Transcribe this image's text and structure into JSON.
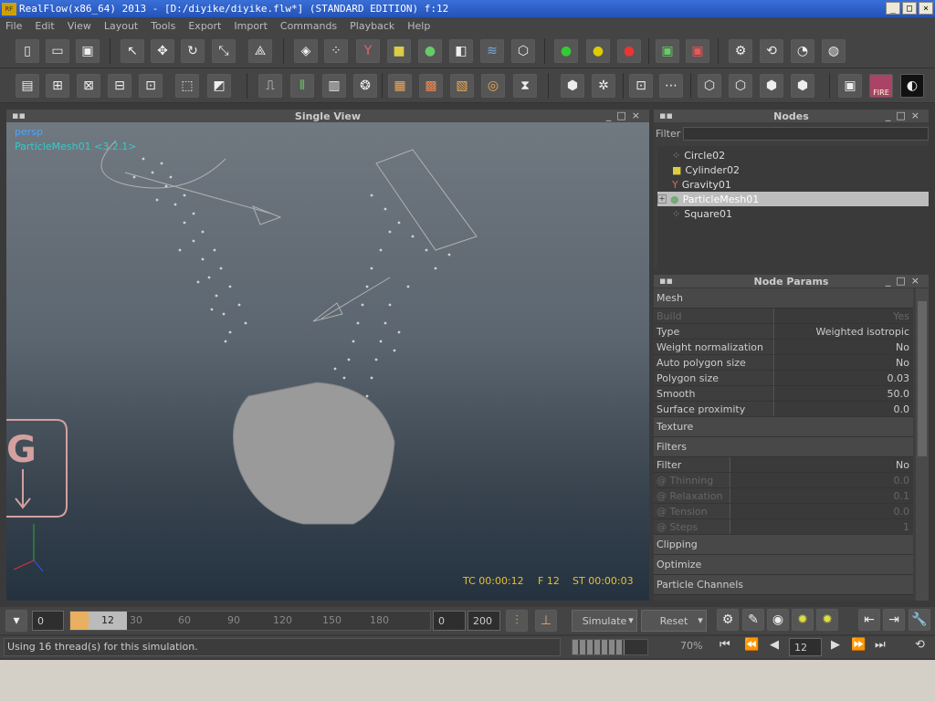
{
  "window": {
    "title": "RealFlow(x86_64) 2013 - [D:/diyike/diyike.flw*] (STANDARD EDITION) f:12",
    "logo_text": "RF",
    "minimize": "_",
    "maximize": "□",
    "close": "×"
  },
  "menu": [
    "File",
    "Edit",
    "View",
    "Layout",
    "Tools",
    "Export",
    "Import",
    "Commands",
    "Playback",
    "Help"
  ],
  "viewport": {
    "title": "Single View",
    "camera": "persp",
    "selected_label": "ParticleMesh01 <3.2.1>",
    "gravity_letter": "G",
    "tc": "TC 00:00:12",
    "frame": "F 12",
    "st": "ST 00:00:03"
  },
  "nodes": {
    "title": "Nodes",
    "filter_label": "Filter",
    "filter_value": "",
    "items": [
      {
        "name": "Circle02",
        "icon": "emitter-icon"
      },
      {
        "name": "Cylinder02",
        "icon": "object-icon"
      },
      {
        "name": "Gravity01",
        "icon": "daemon-icon"
      },
      {
        "name": "ParticleMesh01",
        "icon": "mesh-icon"
      },
      {
        "name": "Square01",
        "icon": "emitter-icon"
      }
    ],
    "selected": "ParticleMesh01"
  },
  "params": {
    "title": "Node Params",
    "mesh_section": "Mesh",
    "rows": [
      {
        "key": "Build",
        "value": "Yes",
        "dim": true
      },
      {
        "key": "Type",
        "value": "Weighted isotropic",
        "dim": false
      },
      {
        "key": "Weight normalization",
        "value": "No",
        "dim": false
      },
      {
        "key": "Auto polygon size",
        "value": "No",
        "dim": false
      },
      {
        "key": "Polygon size",
        "value": "0.03",
        "dim": false
      },
      {
        "key": "Smooth",
        "value": "50.0",
        "dim": false
      },
      {
        "key": "Surface proximity",
        "value": "0.0",
        "dim": false
      }
    ],
    "texture_section": "Texture",
    "filters_section": "Filters",
    "filter_rows": [
      {
        "key": "Filter",
        "value": "No",
        "dim": false
      },
      {
        "key": "@ Thinning",
        "value": "0.0",
        "dim": true
      },
      {
        "key": "@ Relaxation",
        "value": "0.1",
        "dim": true
      },
      {
        "key": "@ Tension",
        "value": "0.0",
        "dim": true
      },
      {
        "key": "@ Steps",
        "value": "1",
        "dim": true
      }
    ],
    "clipping_section": "Clipping",
    "optimize_section": "Optimize",
    "channels_section": "Particle Channels"
  },
  "timeline": {
    "start": "0",
    "current": "12",
    "ticks": [
      "30",
      "60",
      "90",
      "120",
      "150",
      "180"
    ],
    "range_start": "0",
    "range_end": "200",
    "simulate": "Simulate",
    "reset": "Reset"
  },
  "status": {
    "message": "Using 16 thread(s) for this simulation.",
    "progress": 0.7,
    "progress_text": "70%",
    "frame_field": "12"
  },
  "fire_label": "FIRE"
}
